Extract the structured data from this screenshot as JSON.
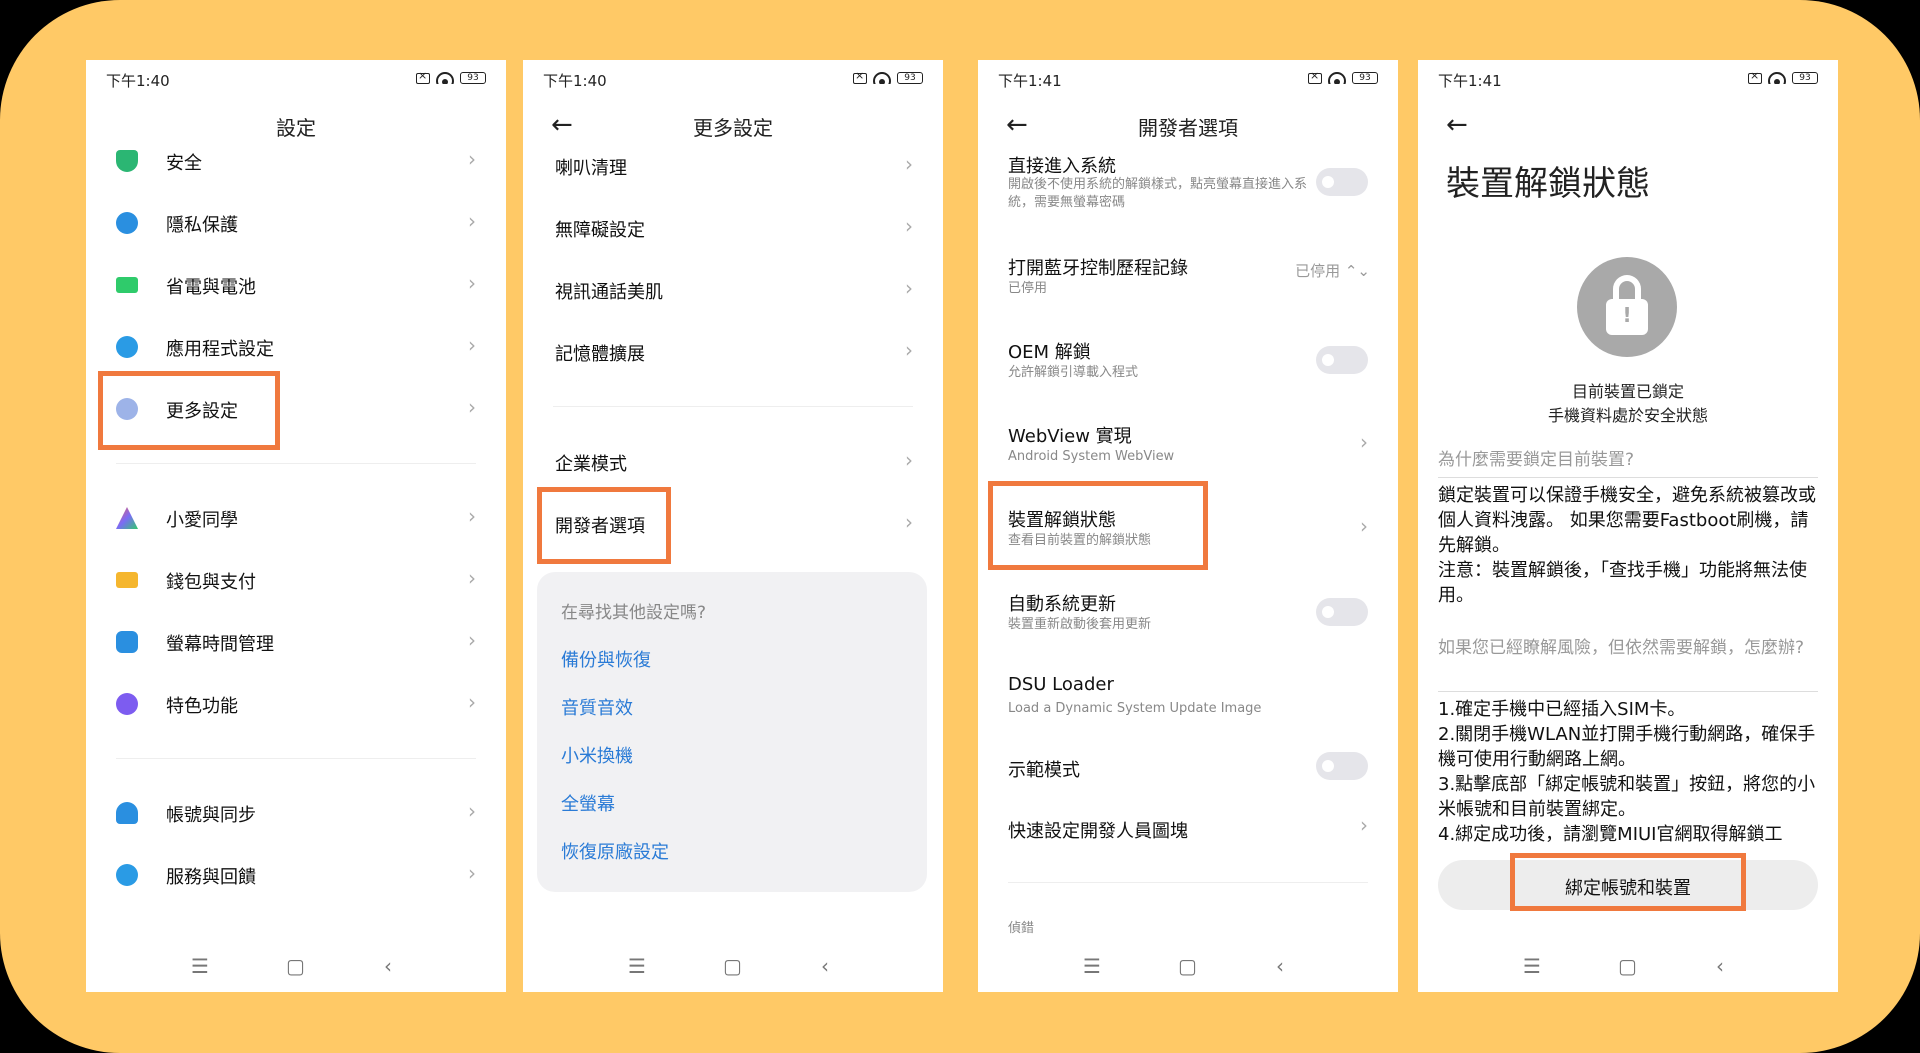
{
  "screens": [
    {
      "time": "下午1:40",
      "battery": "93",
      "title": "設定",
      "items": [
        {
          "label": "安全",
          "color": "#2BB673",
          "icon": "shield-icon"
        },
        {
          "label": "隱私保護",
          "color": "#2A8FE0",
          "icon": "privacy-icon"
        },
        {
          "label": "省電與電池",
          "color": "#2FCB6B",
          "icon": "battery-icon"
        },
        {
          "label": "應用程式設定",
          "color": "#2A9BE5",
          "icon": "gear-icon"
        },
        {
          "label": "更多設定",
          "color": "#9DB3E8",
          "icon": "more-icon"
        },
        {
          "label": "小愛同學",
          "color": "#7B6CF6",
          "icon": "assistant-icon"
        },
        {
          "label": "錢包與支付",
          "color": "#F5B62E",
          "icon": "wallet-icon"
        },
        {
          "label": "螢幕時間管理",
          "color": "#2A8FE0",
          "icon": "hourglass-icon"
        },
        {
          "label": "特色功能",
          "color": "#7D5CF0",
          "icon": "feature-icon"
        },
        {
          "label": "帳號與同步",
          "color": "#2A8FE0",
          "icon": "account-icon"
        },
        {
          "label": "服務與回饋",
          "color": "#2A9BE5",
          "icon": "help-icon"
        }
      ]
    },
    {
      "time": "下午1:40",
      "battery": "93",
      "title": "更多設定",
      "items": [
        "喇叭清理",
        "無障礙設定",
        "視訊通話美肌",
        "記憶體擴展",
        "企業模式",
        "開發者選項"
      ],
      "suggest_title": "在尋找其他設定嗎?",
      "suggest_links": [
        "備份與恢復",
        "音質音效",
        "小米換機",
        "全螢幕",
        "恢復原廠設定"
      ]
    },
    {
      "time": "下午1:41",
      "battery": "93",
      "title": "開發者選項",
      "items": [
        {
          "title": "直接進入系統",
          "sub": "開啟後不使用系統的解鎖樣式，點亮螢幕直接進入系統，需要無螢幕密碼"
        },
        {
          "title": "打開藍牙控制歷程記錄",
          "sub": "已停用",
          "value": "已停用 ⌃⌄"
        },
        {
          "title": "OEM 解鎖",
          "sub": "允許解鎖引導載入程式"
        },
        {
          "title": "WebView 實現",
          "sub": "Android System WebView"
        },
        {
          "title": "裝置解鎖狀態",
          "sub": "查看目前裝置的解鎖狀態"
        },
        {
          "title": "自動系統更新",
          "sub": "裝置重新啟動後套用更新"
        },
        {
          "title": "DSU Loader",
          "sub": "Load a Dynamic System Update Image"
        },
        {
          "title": "示範模式",
          "sub": ""
        },
        {
          "title": "快速設定開發人員圖塊",
          "sub": ""
        }
      ],
      "footer_section": "偵錯"
    },
    {
      "time": "下午1:41",
      "battery": "93",
      "title": "裝置解鎖狀態",
      "status_line1": "目前裝置已鎖定",
      "status_line2": "手機資料處於安全狀態",
      "why_heading": "為什麼需要鎖定目前裝置?",
      "why_text": "鎖定裝置可以保證手機安全，避免系統被篡改或個人資料洩露。 如果您需要Fastboot刷機，請先解鎖。\n注意：裝置解鎖後，「查找手機」功能將無法使用。",
      "how_heading": "如果您已經瞭解風險，但依然需要解鎖，怎麼辦?",
      "steps": [
        "1.確定手機中已經插入SIM卡。",
        "2.關閉手機WLAN並打開手機行動網路，確保手機可使用行動網路上網。",
        "3.點擊底部「綁定帳號和裝置」按鈕，將您的小米帳號和目前裝置綁定。",
        "4.綁定成功後，請瀏覽MIUI官網取得解鎖工"
      ],
      "bind_button": "綁定帳號和裝置"
    }
  ],
  "colors": {
    "highlight": "#F0793E",
    "background": "#FFC966",
    "link": "#2A7BD6"
  }
}
